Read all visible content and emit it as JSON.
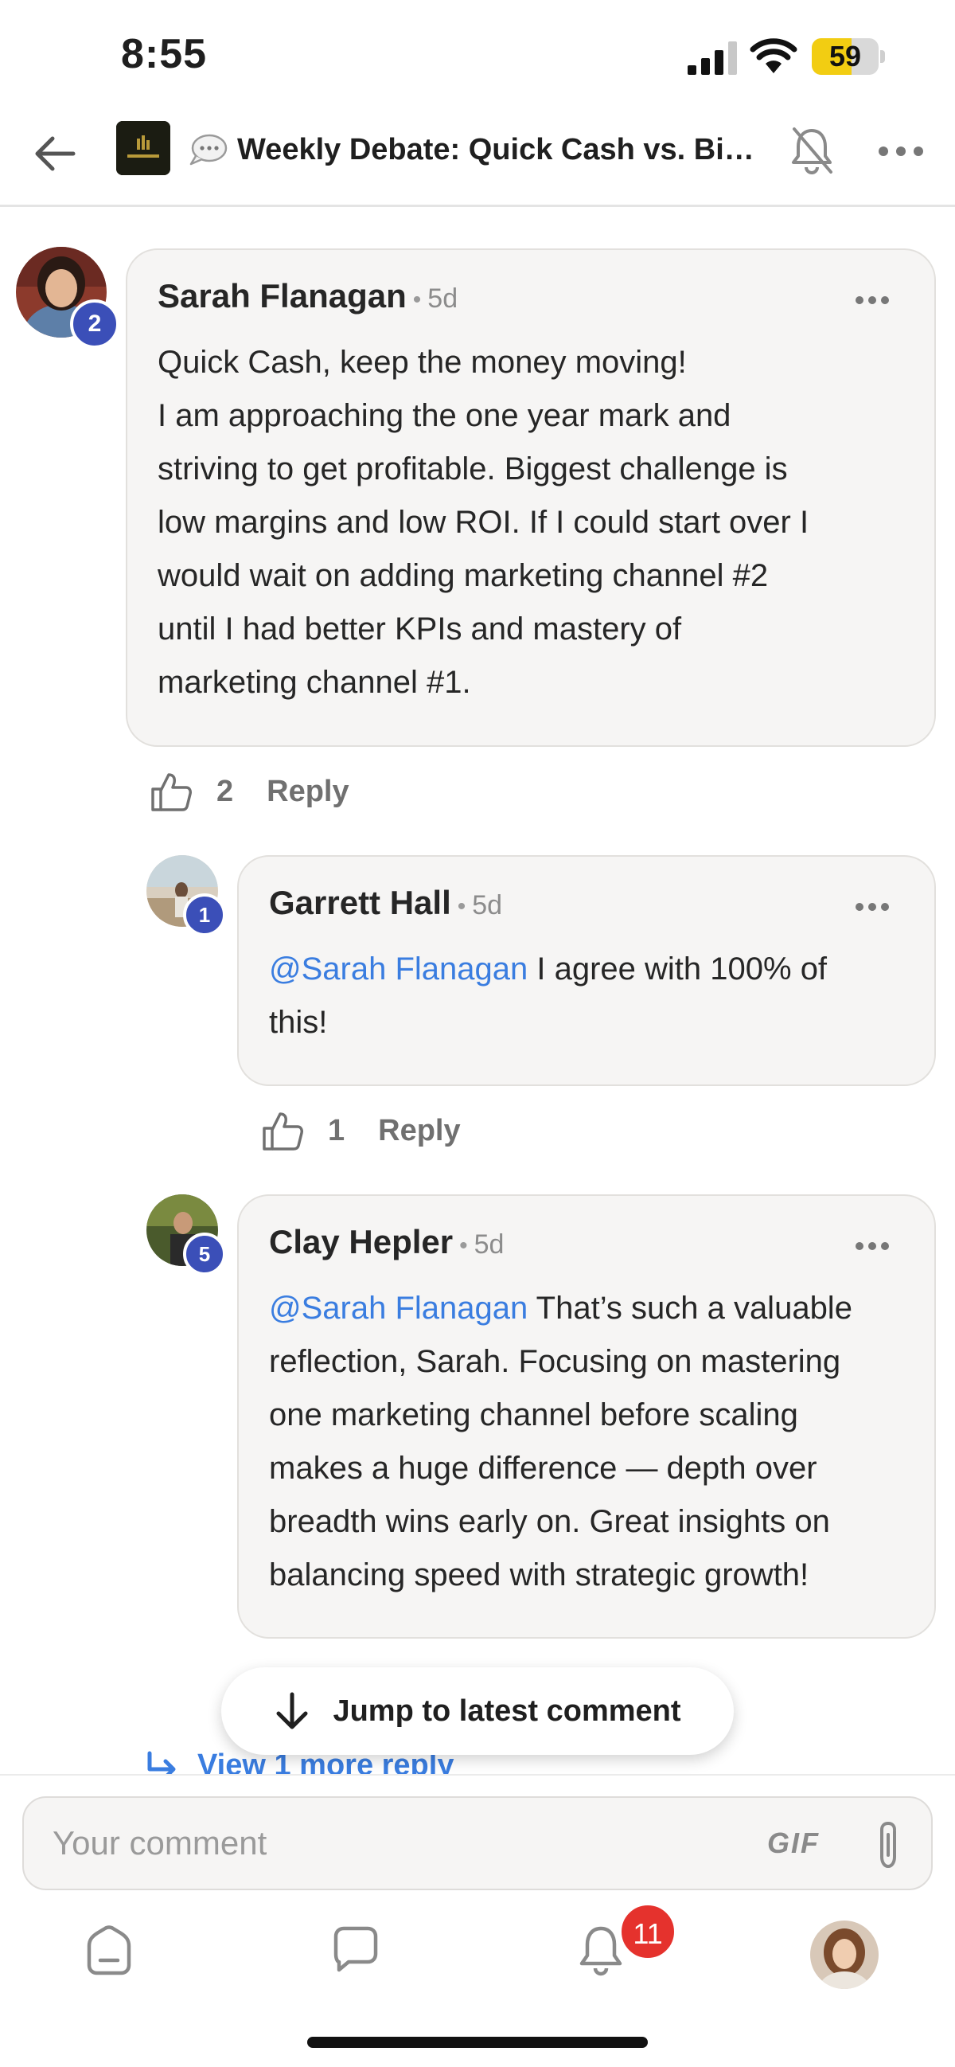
{
  "status_bar": {
    "time": "8:55",
    "battery_level": "59",
    "battery_fraction": 0.59
  },
  "header": {
    "title": "Weekly Debate: Quick Cash vs. Big...",
    "icons": [
      "back-arrow-icon",
      "community-logo",
      "speech-bubble-icon",
      "bell-off-icon",
      "more-horizontal-icon"
    ]
  },
  "comments": [
    {
      "author": "Sarah Flanagan",
      "age": "5d",
      "level": "2",
      "lines": [
        "Quick Cash, keep the money moving!",
        "I am approaching the one year mark and",
        "striving to get profitable. Biggest challenge is",
        "low margins and low ROI. If I could start over I",
        "would wait on adding marketing channel #2",
        "until I had better KPIs and mastery of",
        "marketing channel #1."
      ],
      "likes": "2",
      "reply_label": "Reply"
    },
    {
      "author": "Garrett Hall",
      "age": "5d",
      "level": "1",
      "mention": "@Sarah Flanagan",
      "line1_rest": " I agree with 100% of",
      "lines_rest": [
        "this!"
      ],
      "likes": "1",
      "reply_label": "Reply"
    },
    {
      "author": "Clay Hepler",
      "age": "5d",
      "level": "5",
      "mention": "@Sarah Flanagan",
      "line1_rest": " That’s such a valuable",
      "lines_rest": [
        "reflection, Sarah. Focusing on mastering",
        "one marketing channel before scaling",
        "makes a huge difference — depth over",
        "breadth wins early on. Great insights on",
        "balancing speed with strategic growth!"
      ]
    }
  ],
  "view_more_label": "View 1 more reply",
  "jump_label": "Jump to latest comment",
  "composer": {
    "placeholder": "Your comment",
    "gif_label": "GIF"
  },
  "nav": {
    "notifications_count": "11",
    "items": [
      "home-icon",
      "chat-icon",
      "notifications-icon",
      "profile-avatar"
    ]
  },
  "colors": {
    "mention": "#3a7de0",
    "badge": "#3b4fb8",
    "notif": "#e5322d",
    "battery": "#f2cd12"
  }
}
